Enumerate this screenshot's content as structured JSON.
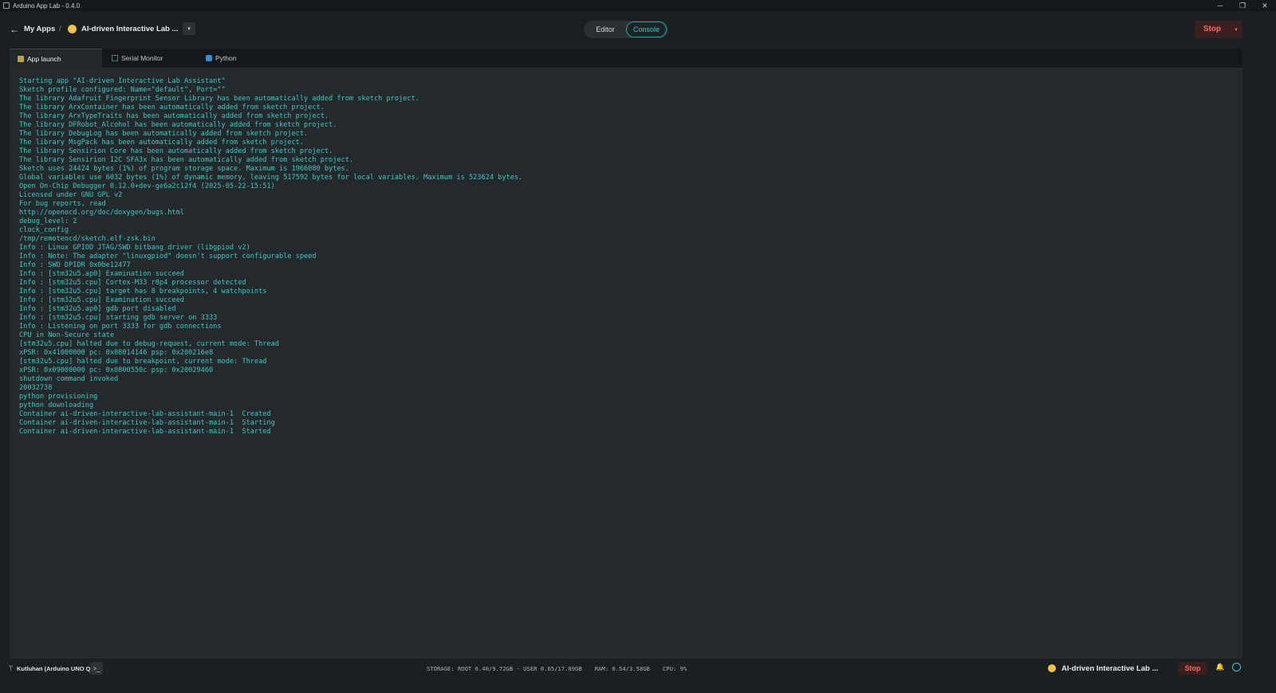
{
  "window": {
    "title": "Arduino App Lab - 0.4.0",
    "controls": [
      "─",
      "❐",
      "✕"
    ]
  },
  "header": {
    "back_icon": "←",
    "breadcrumb_root": "My Apps",
    "breadcrumb_sep": "/",
    "app_icon": "😀",
    "app_name": "AI-driven Interactive Lab ...",
    "dropdown_icon": "▾",
    "modes": {
      "editor": "Editor",
      "console": "Console",
      "active": "console"
    },
    "stop_label": "Stop",
    "stop_caret": "▾"
  },
  "tabs": [
    {
      "label": "App launch",
      "icon": "launch-icon",
      "active": true
    },
    {
      "label": "Serial Monitor",
      "icon": "serial-monitor-icon",
      "active": false
    },
    {
      "label": "Python",
      "icon": "python-icon",
      "active": false
    }
  ],
  "console_lines": [
    "Starting app \"AI-driven Interactive Lab Assistant\"",
    "Sketch profile configured: Name=\"default\", Port=\"\"",
    "The library Adafruit Fingerprint Sensor Library has been automatically added from sketch project.",
    "The library ArxContainer has been automatically added from sketch project.",
    "The library ArxTypeTraits has been automatically added from sketch project.",
    "The library DFRobot_Alcohol has been automatically added from sketch project.",
    "The library DebugLog has been automatically added from sketch project.",
    "The library MsgPack has been automatically added from sketch project.",
    "The library Sensirion Core has been automatically added from sketch project.",
    "The library Sensirion I2C SFA3x has been automatically added from sketch project.",
    "Sketch uses 24424 bytes (1%) of program storage space. Maximum is 1966080 bytes.",
    "Global variables use 6032 bytes (1%) of dynamic memory, leaving 517592 bytes for local variables. Maximum is 523624 bytes.",
    "Open On-Chip Debugger 0.12.0+dev-ge6a2c12f4 (2025-05-22-15:51)",
    "Licensed under GNU GPL v2",
    "For bug reports, read",
    "http://openocd.org/doc/doxygen/bugs.html",
    "debug_level: 2",
    "clock_config",
    "/tmp/remoteocd/sketch.elf-zsk.bin",
    "Info : Linux GPIOD JTAG/SWD bitbang driver (libgpiod v2)",
    "Info : Note: The adapter \"linuxgpiod\" doesn't support configurable speed",
    "Info : SWD DPIDR 0x0be12477",
    "Info : [stm32u5.ap0] Examination succeed",
    "Info : [stm32u5.cpu] Cortex-M33 r0p4 processor detected",
    "Info : [stm32u5.cpu] target has 8 breakpoints, 4 watchpoints",
    "Info : [stm32u5.cpu] Examination succeed",
    "Info : [stm32u5.ap0] gdb port disabled",
    "Info : [stm32u5.cpu] starting gdb server on 3333",
    "Info : Listening on port 3333 for gdb connections",
    "CPU in Non-Secure state",
    "[stm32u5.cpu] halted due to debug-request, current mode: Thread",
    "xPSR: 0x41000000 pc: 0x08014146 psp: 0x200216e8",
    "[stm32u5.cpu] halted due to breakpoint, current mode: Thread",
    "xPSR: 0x09000000 pc: 0x0800550c psp: 0x20029460",
    "shutdown command invoked",
    "20032738",
    "python provisioning",
    "python downloading",
    "Container ai-driven-interactive-lab-assistant-main-1  Created",
    "Container ai-driven-interactive-lab-assistant-main-1  Starting",
    "Container ai-driven-interactive-lab-assistant-main-1  Started"
  ],
  "statusbar": {
    "board_icon": "usb-icon",
    "board_label": "Kutluhan (Arduino UNO Q)",
    "terminal_icon": ">_",
    "storage": "STORAGE: ROOT 6.40/9.72GB - USER 0.65/17.89GB",
    "ram": "RAM: 0.54/3.58GB",
    "cpu": "CPU: 9%",
    "app_icon": "😀",
    "app_name": "AI-driven Interactive Lab ...",
    "stop_label": "Stop",
    "bell_icon": "🔔"
  },
  "colors": {
    "accent": "#39c8c3",
    "stop": "#ff6a5e",
    "console_text": "#3ec7c0",
    "background": "#1b1f21"
  }
}
